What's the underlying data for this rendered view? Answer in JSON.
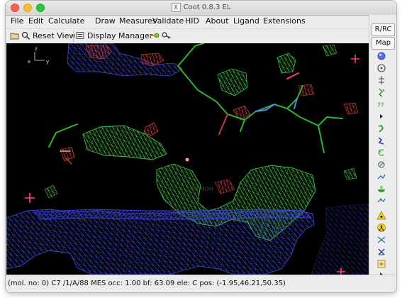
{
  "window": {
    "title": "Coot 0.8.3 EL",
    "app_icon_glyph": "X"
  },
  "menu": [
    {
      "label": "File"
    },
    {
      "label": "Edit"
    },
    {
      "label": "Calculate"
    },
    {
      "label": "Draw"
    },
    {
      "label": "Measures"
    },
    {
      "label": "Validate"
    },
    {
      "label": "HID"
    },
    {
      "label": "About"
    },
    {
      "label": "Ligand"
    },
    {
      "label": "Extensions"
    }
  ],
  "toolbar": {
    "reset_view_label": "Reset View",
    "display_manager_label": "Display Manager",
    "icons": [
      "folder-open-icon",
      "zoom-icon",
      "display-manager-icon",
      "go-to-atom-icon",
      "key-icon"
    ]
  },
  "right_panel": {
    "rrc_label": "R/RC",
    "map_label": "Map",
    "icons": [
      "sphere-refine-icon",
      "rotate-translate-icon",
      "backbone-torsion-icon",
      "rotamer-icon",
      "flip-peptide-icon",
      "more-arrow-icon",
      "add-residue-icon",
      "auto-fit-icon",
      "undo-icon",
      "density-fit-icon",
      "mutate-icon",
      "baton-icon",
      "ligand-icon",
      "radiation-icon",
      "toxic-icon",
      "cross-link-icon",
      "delete-icon",
      "add-atom-icon",
      "expand-arrow-icon"
    ]
  },
  "viewport": {
    "axis_labels": [
      "x",
      "z",
      "y"
    ],
    "faint_label": "-37 HOH",
    "colors": {
      "background": "#000000",
      "map_2fofc": "#3a44d0",
      "map_positive": "#3fbf3f",
      "map_negative": "#c63a3a",
      "bonds": "#29b82a",
      "water_marker": "#ff3a80",
      "nitrogen": "#6e78ff"
    }
  },
  "status": {
    "text": "(mol. no: 0)  C7 /1/A/88 MES occ:   1.00 bf:  63.09 ele:   C pos: (-1.95,46.21,50.35)"
  }
}
